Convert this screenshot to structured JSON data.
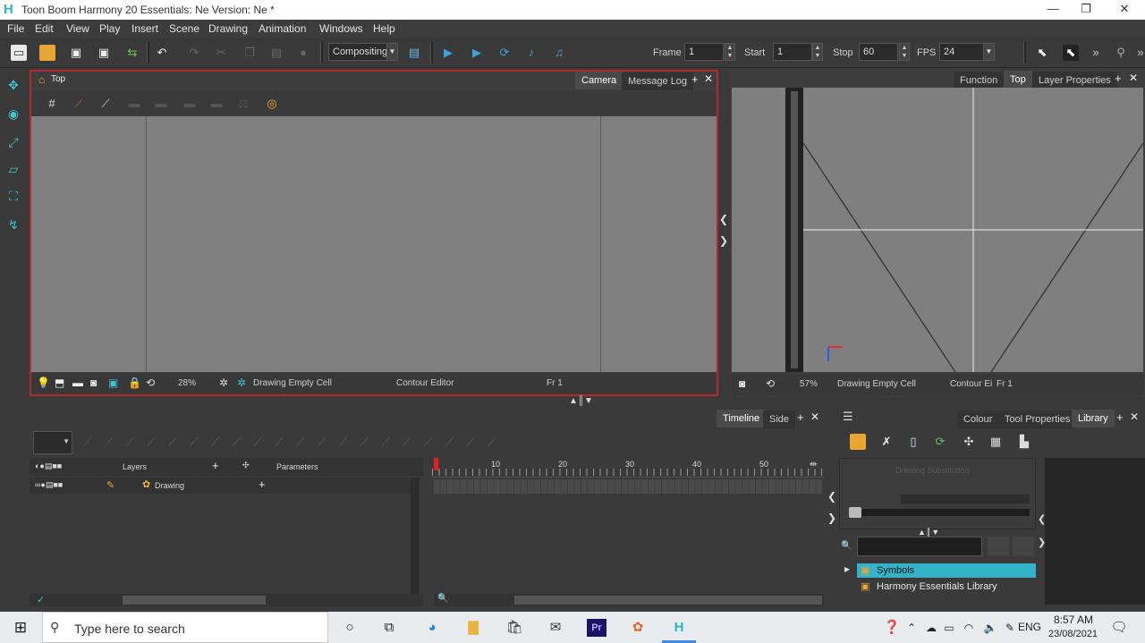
{
  "window": {
    "title": "Toon Boom Harmony 20 Essentials: Ne Version: Ne *",
    "minimize": "—",
    "maximize": "❐",
    "close": "✕"
  },
  "menu": [
    "File",
    "Edit",
    "View",
    "Play",
    "Insert",
    "Scene",
    "Drawing",
    "Animation",
    "Windows",
    "Help"
  ],
  "toolbar": {
    "mode_select": "Compositing",
    "frame_label": "Frame",
    "frame_value": "1",
    "start_label": "Start",
    "start_value": "1",
    "stop_label": "Stop",
    "stop_value": "60",
    "fps_label": "FPS",
    "fps_value": "24"
  },
  "top_view": {
    "title": "Top",
    "tabs": [
      "Camera",
      "Message Log"
    ],
    "zoom": "28%",
    "drawing_status": "Drawing Empty Cell",
    "editor_status": "Contour Editor",
    "frame_status": "Fr 1"
  },
  "camera_view": {
    "tabs": [
      "Function",
      "Top",
      "Layer Properties"
    ],
    "zoom": "57%",
    "drawing_status": "Drawing Empty Cell",
    "editor_status": "Contour Ei",
    "frame_status": "Fr 1"
  },
  "timeline": {
    "tabs": [
      "Timeline",
      "Side"
    ],
    "layers_header": "Layers",
    "parameters_header": "Parameters",
    "layer_name": "Drawing",
    "ruler": [
      "10",
      "20",
      "30",
      "40",
      "50"
    ]
  },
  "library": {
    "tabs": [
      "Colour",
      "Tool Properties",
      "Library"
    ],
    "drawing_substitution": "Drawing Substitution",
    "tree": [
      "Symbols",
      "Harmony Essentials Library"
    ]
  },
  "taskbar": {
    "search_placeholder": "Type here to search",
    "language": "ENG",
    "time": "8:57 AM",
    "date": "23/08/2021"
  },
  "colors": {
    "accent": "#3fc2d6",
    "active_border": "#b22a2a",
    "selected_tree": "#34b3c8"
  }
}
